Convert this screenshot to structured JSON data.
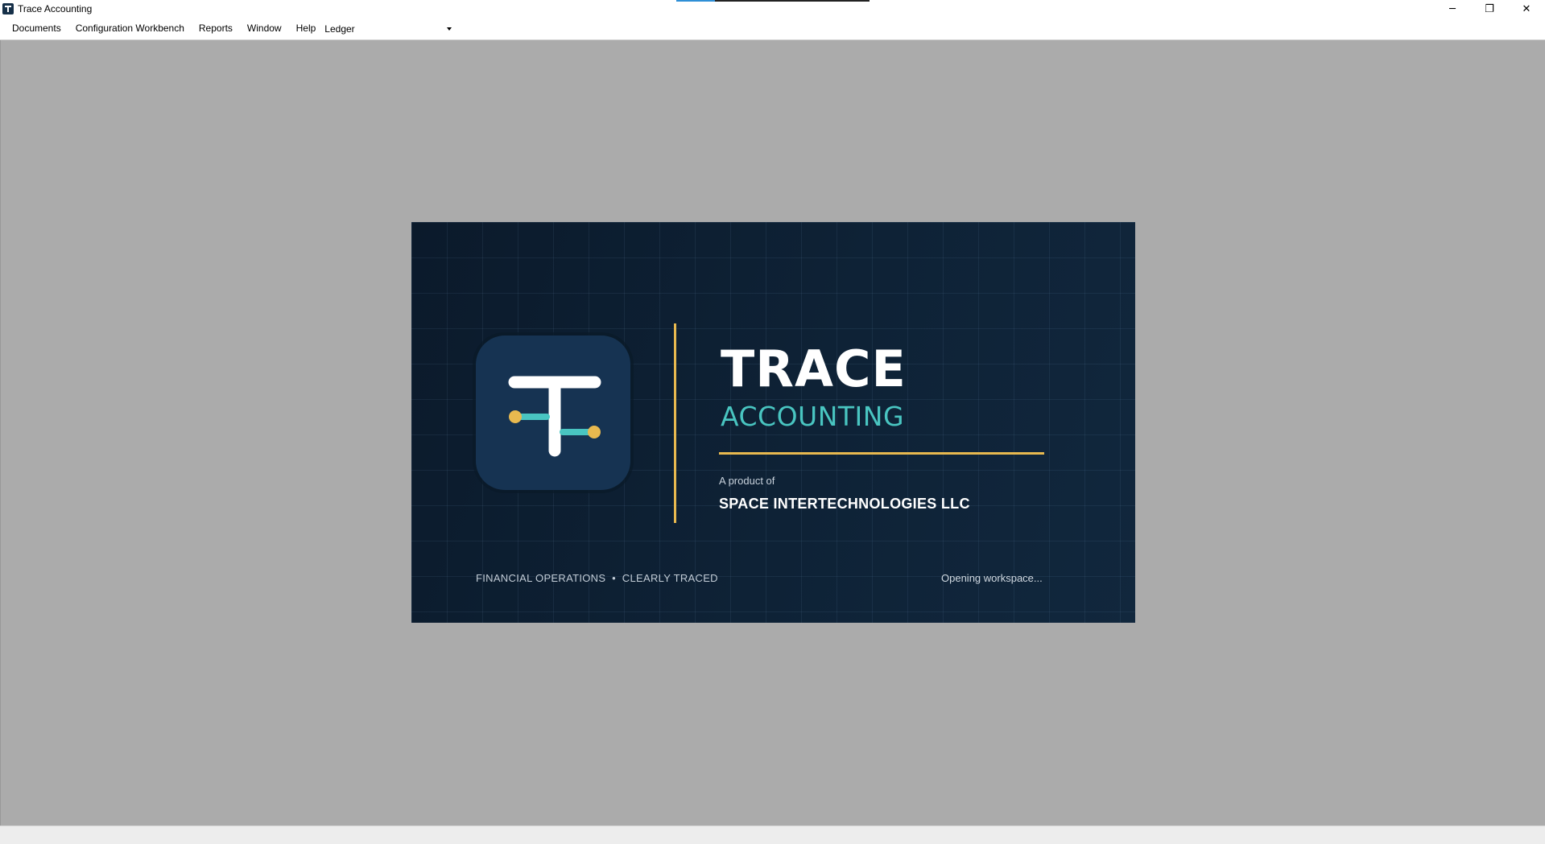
{
  "window": {
    "title": "Trace Accounting",
    "controls": [
      "─",
      "❐",
      "✕"
    ],
    "load_progress": 0.2
  },
  "menu": {
    "items": [
      "Documents",
      "Configuration Workbench",
      "Reports",
      "Window",
      "Help"
    ],
    "ledger_label": "Ledger",
    "ledger_value": ""
  },
  "splash": {
    "title": "TRACE",
    "subtitle": "ACCOUNTING",
    "product_of": "A product of",
    "company": "SPACE INTERTECHNOLOGIES LLC",
    "tagline": "FINANCIAL OPERATIONS  •  CLEARLY TRACED",
    "status": "Opening workspace...",
    "colors": {
      "background": "#0e2236",
      "accent_gold": "#e8b94f",
      "accent_teal": "#49c5c1",
      "tile": "#163352"
    },
    "icons": [
      "trace-logo-icon"
    ]
  }
}
